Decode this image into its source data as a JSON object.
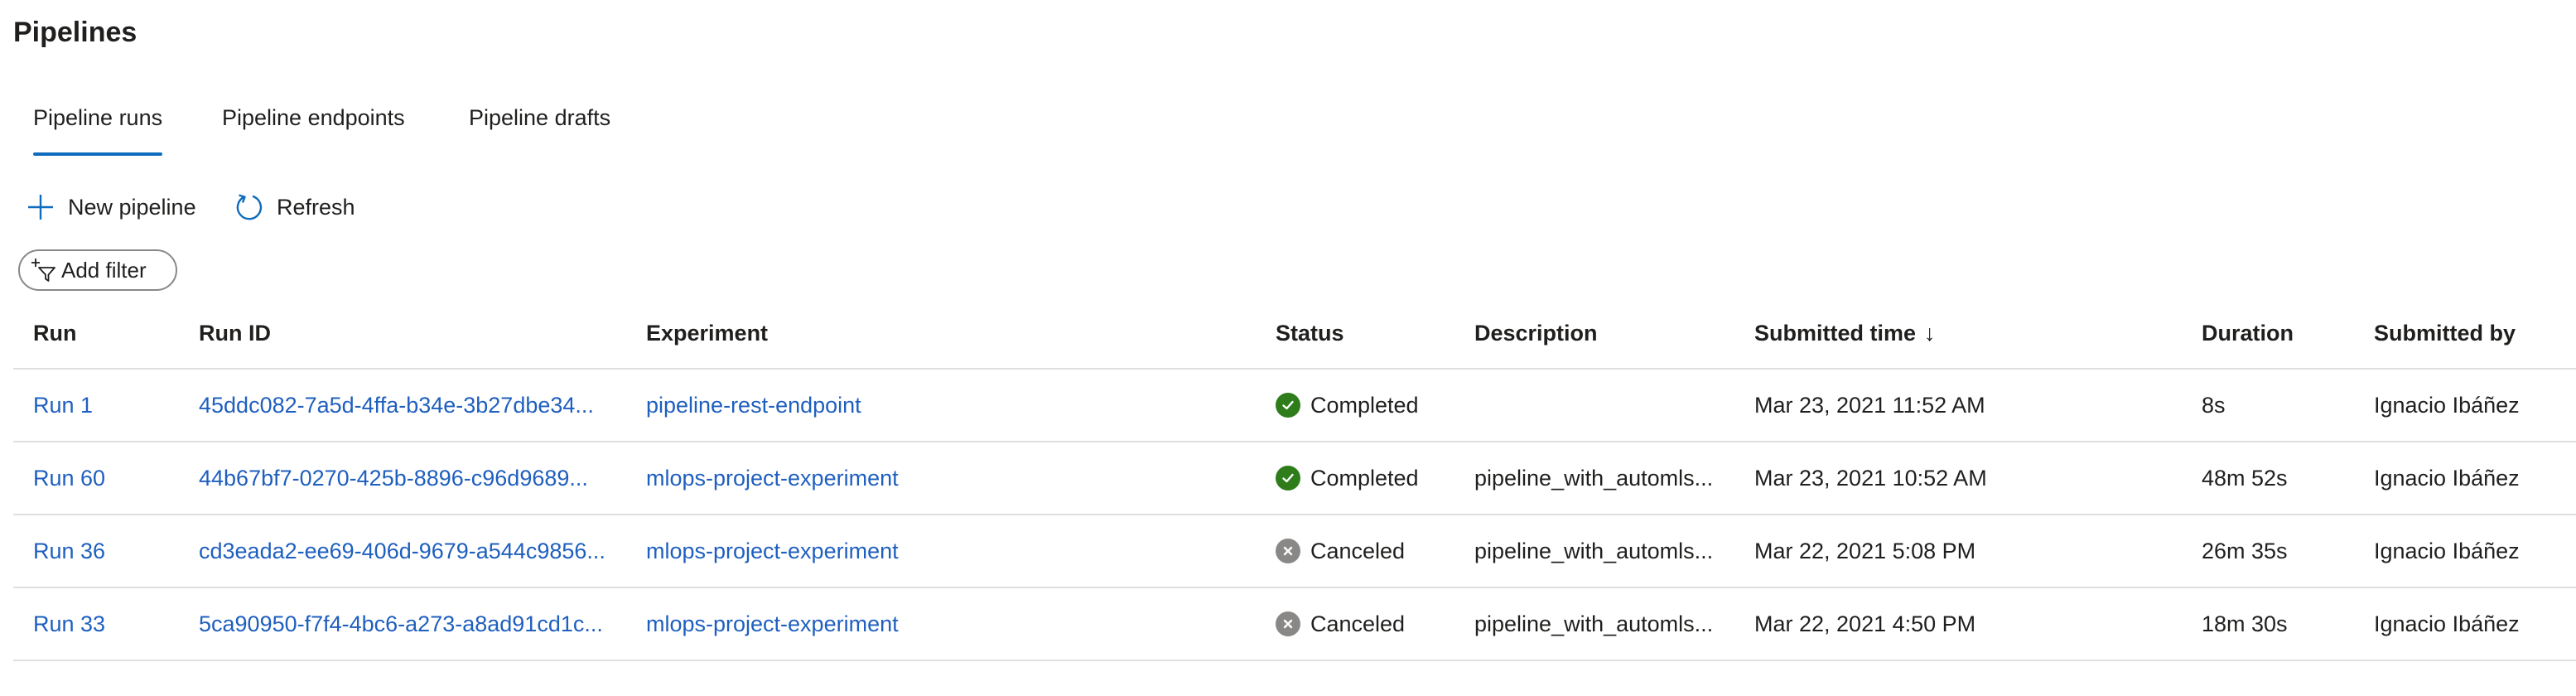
{
  "page": {
    "title": "Pipelines"
  },
  "tabs": [
    {
      "label": "Pipeline runs",
      "active": true
    },
    {
      "label": "Pipeline endpoints",
      "active": false
    },
    {
      "label": "Pipeline drafts",
      "active": false
    }
  ],
  "toolbar": {
    "new_pipeline": {
      "label": "New pipeline",
      "icon": "plus-icon"
    },
    "refresh": {
      "label": "Refresh",
      "icon": "refresh-icon"
    }
  },
  "filter": {
    "label": "Add filter",
    "icon": "add-filter-icon"
  },
  "table": {
    "columns": {
      "run": "Run",
      "run_id": "Run ID",
      "experiment": "Experiment",
      "status": "Status",
      "description": "Description",
      "submitted_time": "Submitted time",
      "submitted_time_sort": "↓",
      "duration": "Duration",
      "submitted_by": "Submitted by"
    },
    "rows": [
      {
        "run": "Run 1",
        "run_id": "45ddc082-7a5d-4ffa-b34e-3b27dbe34...",
        "experiment": "pipeline-rest-endpoint",
        "status": "Completed",
        "status_kind": "completed",
        "description": "",
        "submitted_time": "Mar 23, 2021 11:52 AM",
        "duration": "8s",
        "submitted_by": "Ignacio Ibáñez"
      },
      {
        "run": "Run 60",
        "run_id": "44b67bf7-0270-425b-8896-c96d9689...",
        "experiment": "mlops-project-experiment",
        "status": "Completed",
        "status_kind": "completed",
        "description": "pipeline_with_automls...",
        "submitted_time": "Mar 23, 2021 10:52 AM",
        "duration": "48m 52s",
        "submitted_by": "Ignacio Ibáñez"
      },
      {
        "run": "Run 36",
        "run_id": "cd3eada2-ee69-406d-9679-a544c9856...",
        "experiment": "mlops-project-experiment",
        "status": "Canceled",
        "status_kind": "canceled",
        "description": "pipeline_with_automls...",
        "submitted_time": "Mar 22, 2021 5:08 PM",
        "duration": "26m 35s",
        "submitted_by": "Ignacio Ibáñez"
      },
      {
        "run": "Run 33",
        "run_id": "5ca90950-f7f4-4bc6-a273-a8ad91cd1c...",
        "experiment": "mlops-project-experiment",
        "status": "Canceled",
        "status_kind": "canceled",
        "description": "pipeline_with_automls...",
        "submitted_time": "Mar 22, 2021 4:50 PM",
        "duration": "18m 30s",
        "submitted_by": "Ignacio Ibáñez"
      }
    ]
  },
  "colors": {
    "accent": "#0f6cbd",
    "link": "#1f5fbf",
    "completed": "#2e7d1a",
    "canceled": "#8a8886",
    "divider": "#e1dfdd"
  }
}
